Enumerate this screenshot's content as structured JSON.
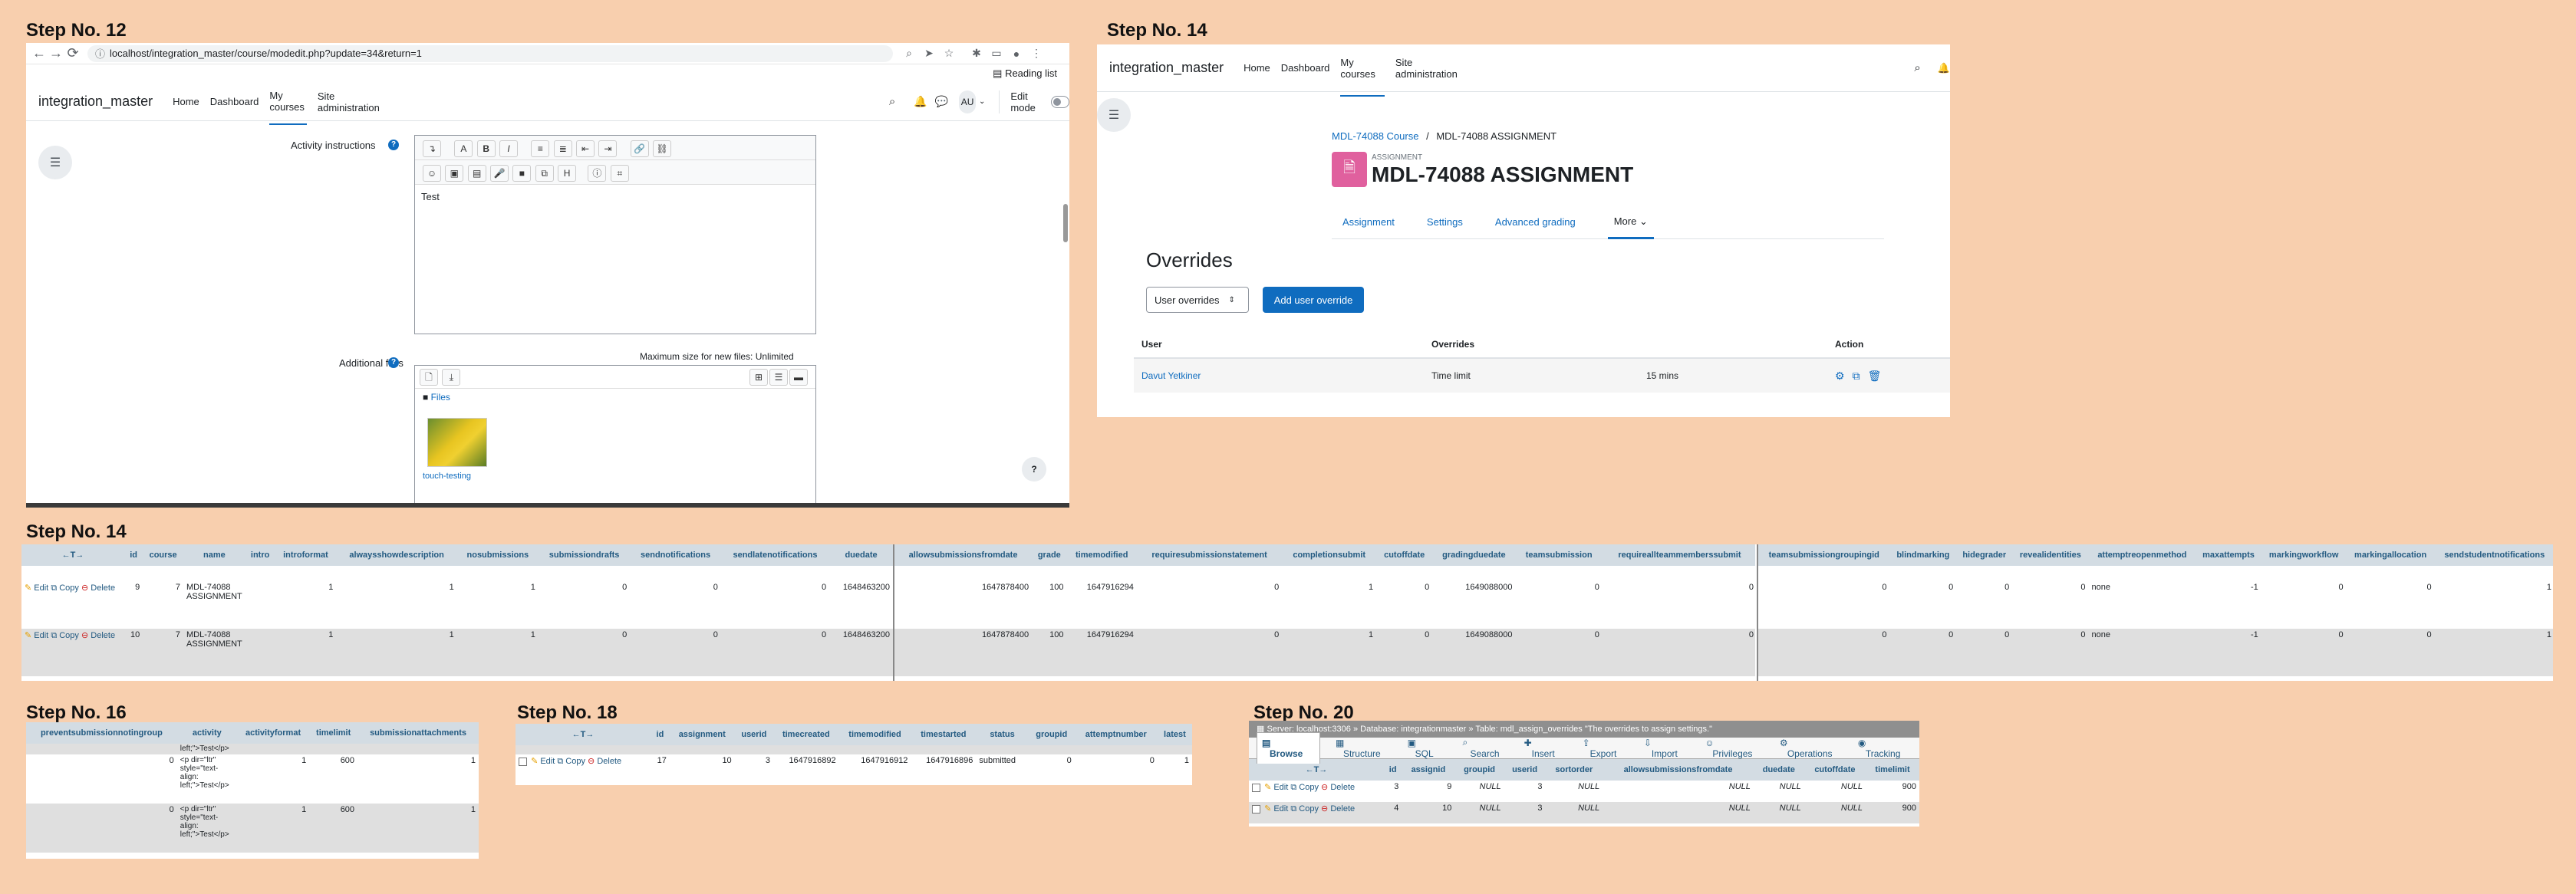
{
  "steps": {
    "s12": "Step No. 12",
    "s14a": "Step No. 14",
    "s14b": "Step No. 14",
    "s16": "Step No. 16",
    "s18": "Step No. 18",
    "s20": "Step No. 20"
  },
  "step12": {
    "url": "localhost/integration_master/course/modedit.php?update=34&return=1",
    "reading_list": "Reading list",
    "brand": "integration_master",
    "nav": [
      "Home",
      "Dashboard",
      "My courses",
      "Site administration"
    ],
    "avatar": "AU",
    "edit_mode": "Edit mode",
    "activity_instructions": "Activity instructions",
    "editor_text": "Test",
    "additional_files": "Additional files",
    "max_size": "Maximum size for new files: Unlimited",
    "files_folder": "Files",
    "file_name": "touch-testing"
  },
  "step14a": {
    "brand": "integration_master",
    "nav": [
      "Home",
      "Dashboard",
      "My courses",
      "Site administration"
    ],
    "breadcrumb_course": "MDL-74088 Course",
    "breadcrumb_sep": "/",
    "breadcrumb_current": "MDL-74088 ASSIGNMENT",
    "activity_type": "ASSIGNMENT",
    "title": "MDL-74088 ASSIGNMENT",
    "tabs": [
      "Assignment",
      "Settings",
      "Advanced grading",
      "More"
    ],
    "heading": "Overrides",
    "select_value": "User overrides",
    "add_button": "Add user override",
    "columns": [
      "User",
      "Overrides",
      "Action"
    ],
    "row_user": "Davut Yetkiner",
    "row_override": "Time limit",
    "row_value": "15 mins"
  },
  "step14b": {
    "columns_left": [
      "id",
      "course",
      "name",
      "intro",
      "introformat",
      "alwaysshowdescription",
      "nosubmissions",
      "submissiondrafts",
      "sendnotifications",
      "sendlatenotifications",
      "duedate"
    ],
    "columns_mid": [
      "allowsubmissionsfromdate",
      "grade",
      "timemodified",
      "requiresubmissionstatement",
      "completionsubmit",
      "cutoffdate",
      "gradingduedate",
      "teamsubmission",
      "requireallteammemberssubmit"
    ],
    "columns_right": [
      "teamsubmissiongroupingid",
      "blindmarking",
      "hidegrader",
      "revealidentities",
      "attemptreopenmethod",
      "maxattempts",
      "markingworkflow",
      "markingallocation",
      "sendstudentnotifications"
    ],
    "rows": [
      {
        "id": "9",
        "course": "7",
        "name": "MDL-74088 ASSIGNMENT",
        "intro": "",
        "introformat": "1",
        "always": "1",
        "nosub": "1",
        "drafts": "0",
        "notif": "0",
        "late": "0",
        "due": "1648463200",
        "allowfrom": "1647878400",
        "grade": "100",
        "modified": "1647916294",
        "stmt": "0",
        "compl": "1",
        "cutoff": "0",
        "gradingdue": "1649088000",
        "team": "0",
        "reqall": "0",
        "grouping": "0",
        "blind": "0",
        "hide": "0",
        "reveal": "0",
        "reopen": "none",
        "maxatt": "-1",
        "workflow": "0",
        "alloc": "0",
        "sendstud": "1"
      },
      {
        "id": "10",
        "course": "7",
        "name": "MDL-74088 ASSIGNMENT",
        "intro": "",
        "introformat": "1",
        "always": "1",
        "nosub": "1",
        "drafts": "0",
        "notif": "0",
        "late": "0",
        "due": "1648463200",
        "allowfrom": "1647878400",
        "grade": "100",
        "modified": "1647916294",
        "stmt": "0",
        "compl": "1",
        "cutoff": "0",
        "gradingdue": "1649088000",
        "team": "0",
        "reqall": "0",
        "grouping": "0",
        "blind": "0",
        "hide": "0",
        "reveal": "0",
        "reopen": "none",
        "maxatt": "-1",
        "workflow": "0",
        "alloc": "0",
        "sendstud": "1"
      }
    ]
  },
  "step16": {
    "columns": [
      "preventsubmissionnotingroup",
      "activity",
      "activityformat",
      "timelimit",
      "submissionattachments"
    ],
    "rows": [
      {
        "prevent": "0",
        "activity": "<p dir=\"ltr\" style=\"text-align: left;\">Test</p>",
        "format": "1",
        "timelimit": "600",
        "attach": "1"
      },
      {
        "prevent": "0",
        "activity": "<p dir=\"ltr\" style=\"text-align: left;\">Test</p>",
        "format": "1",
        "timelimit": "600",
        "attach": "1"
      }
    ],
    "clipped_top": "left;\">Test</p>"
  },
  "step18": {
    "columns": [
      "id",
      "assignment",
      "userid",
      "timecreated",
      "timemodified",
      "timestarted",
      "status",
      "groupid",
      "attemptnumber",
      "latest"
    ],
    "row": {
      "id": "17",
      "assignment": "10",
      "userid": "3",
      "created": "1647916892",
      "modified": "1647916912",
      "started": "1647916896",
      "status": "submitted",
      "groupid": "0",
      "attempt": "0",
      "latest": "1"
    }
  },
  "step20": {
    "breadcrumb": "Server: localhost:3306 » Database: integrationmaster » Table: mdl_assign_overrides \"The overrides to assign settings.\"",
    "tabs": [
      "Browse",
      "Structure",
      "SQL",
      "Search",
      "Insert",
      "Export",
      "Import",
      "Privileges",
      "Operations",
      "Tracking"
    ],
    "columns": [
      "id",
      "assignid",
      "groupid",
      "userid",
      "sortorder",
      "allowsubmissionsfromdate",
      "duedate",
      "cutoffdate",
      "timelimit"
    ],
    "rows": [
      {
        "id": "3",
        "assignid": "9",
        "groupid": "NULL",
        "userid": "3",
        "sortorder": "NULL",
        "allow": "NULL",
        "due": "NULL",
        "cutoff": "NULL",
        "timelimit": "900"
      },
      {
        "id": "4",
        "assignid": "10",
        "groupid": "NULL",
        "userid": "3",
        "sortorder": "NULL",
        "allow": "NULL",
        "due": "NULL",
        "cutoff": "NULL",
        "timelimit": "900"
      }
    ]
  },
  "actions": {
    "edit": "Edit",
    "copy": "Copy",
    "delete": "Delete"
  },
  "colors": {
    "background": "#f8cfae",
    "moodle_blue": "#0f6cbf",
    "assign_pink": "#e0609e",
    "pma_header": "#d3dce3"
  }
}
